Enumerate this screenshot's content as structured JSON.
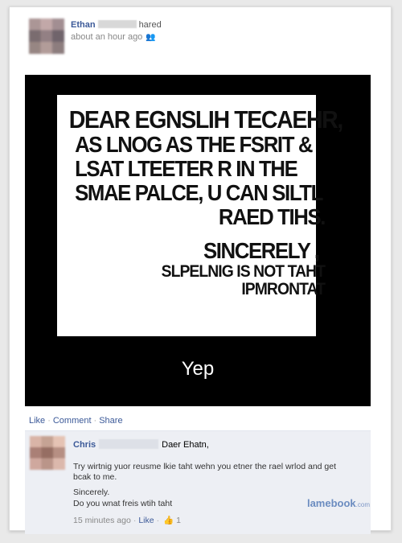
{
  "post": {
    "author": "Ethan",
    "action": "hared",
    "timestamp": "about an hour ago",
    "audience_icon": "friends-icon"
  },
  "image": {
    "sign": {
      "line1": "DEAR EGNSLIH TECAEHR,",
      "line2": "AS LNOG AS THE FSRIT &",
      "line3": "LSAT LTEETER R IN THE",
      "line4": "SMAE PALCE, U CAN SILTL",
      "line5": "RAED TIHS.",
      "sincerely": "SINCERELY ,",
      "sub1": "SLPELNIG IS NOT TAHT",
      "sub2": "IPMRONTAT"
    },
    "caption": "Yep"
  },
  "actions": {
    "like": "Like",
    "comment": "Comment",
    "share": "Share"
  },
  "comment": {
    "author": "Chris",
    "line0": "Daer Ehatn,",
    "paragraph": "Try wirtnig yuor reusme lkie taht wehn you etner the rael wrlod and get bcak to me.",
    "closing1": "Sincerely.",
    "closing2": "Do you wnat freis wtih taht",
    "time": "15 minutes ago",
    "like": "Like",
    "like_count": "1"
  },
  "watermark": {
    "brand": "lamebook",
    "suffix": ".com"
  },
  "colors": {
    "link": "#3b5998",
    "comment_bg": "#edeff4",
    "media_bg": "#000000"
  }
}
